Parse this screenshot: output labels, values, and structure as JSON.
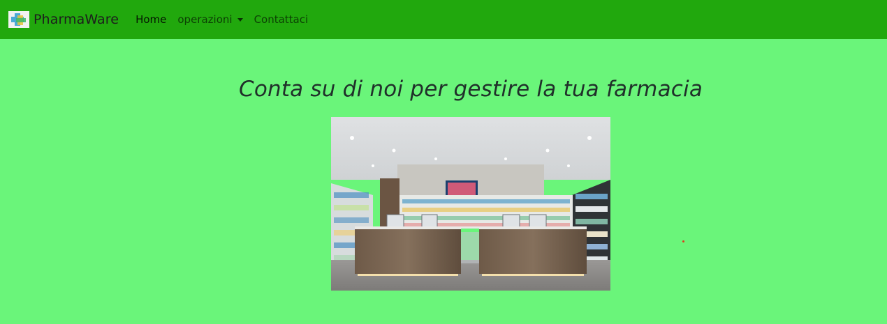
{
  "navbar": {
    "brand": "PharmaWare",
    "logo_icon": "pharmacy-cross-icon",
    "links": [
      {
        "label": "Home",
        "active": true
      },
      {
        "label": "operazioni",
        "dropdown": true
      },
      {
        "label": "Contattaci"
      }
    ],
    "dropdown_icon": "chevron-down-icon"
  },
  "main": {
    "headline": "Conta su di noi per gestire la tua farmacia",
    "hero_image": "pharmacy-interior-photo"
  },
  "colors": {
    "navbar_bg": "#21a80d",
    "page_bg": "#6af57a"
  }
}
